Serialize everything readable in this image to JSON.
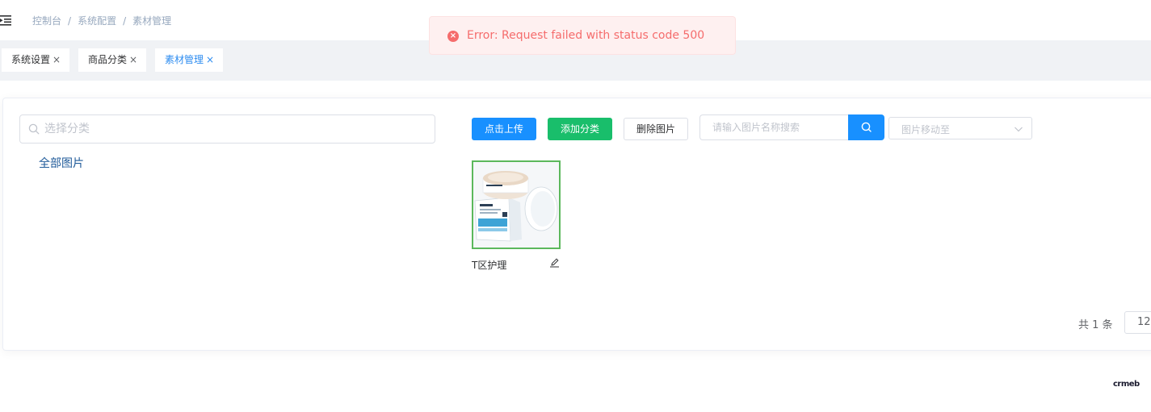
{
  "breadcrumb": {
    "items": [
      "控制台",
      "系统配置",
      "素材管理"
    ],
    "separator": "/"
  },
  "tags": [
    {
      "label": "系统设置",
      "active": false
    },
    {
      "label": "商品分类",
      "active": false
    },
    {
      "label": "素材管理",
      "active": true
    }
  ],
  "tag_close_glyph": "×",
  "toast": {
    "type": "error",
    "icon": "error-circle-icon",
    "message": "Error: Request failed with status code 500",
    "color": "#f56c6c"
  },
  "category_panel": {
    "search_placeholder": "选择分类",
    "all_images_label": "全部图片"
  },
  "toolbar": {
    "upload_label": "点击上传",
    "add_category_label": "添加分类",
    "delete_label": "删除图片",
    "image_search_placeholder": "请输入图片名称搜索",
    "move_to_placeholder": "图片移动至"
  },
  "images": [
    {
      "name": "T区护理",
      "selected": true
    }
  ],
  "pagination": {
    "total_text": "共 1 条",
    "page_size": "12"
  },
  "footer": {
    "logo_text": "crmeb"
  },
  "colors": {
    "primary": "#1890ff",
    "success": "#19be6b",
    "error": "#f56c6c",
    "selected_border": "#5cb85c",
    "active_tag": "#2d8cf0"
  }
}
